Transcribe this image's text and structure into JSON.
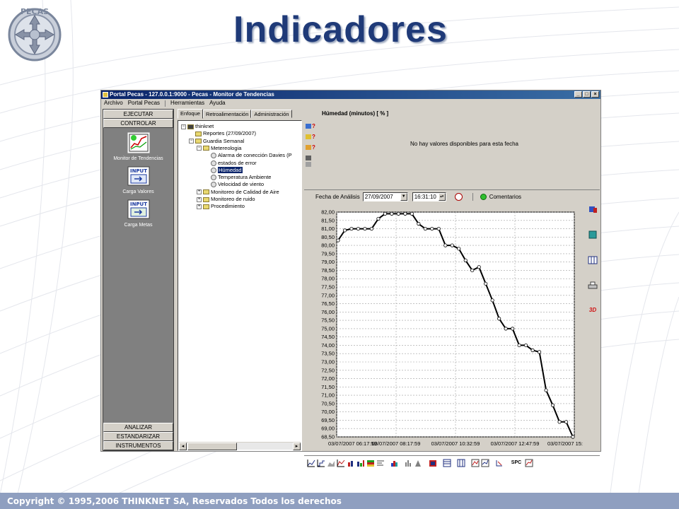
{
  "slide": {
    "title": "Indicadores",
    "logo_text": "PECAS",
    "footer": "Copyright © 1995,2006 THINKNET SA, Reservados Todos los derechos"
  },
  "window": {
    "title": "Portal Pecas - 127.0.0.1:9000 - Pecas - Monitor de Tendencias",
    "buttons": [
      "_",
      "□",
      "×"
    ],
    "menu": [
      "Archivo",
      "Portal Pecas",
      "Herramientas",
      "Ayuda"
    ]
  },
  "left_panel": {
    "sections_top": [
      "EJECUTAR",
      "CONTROLAR"
    ],
    "items": [
      {
        "label": "Monitor de Tendencias",
        "icon": "trend-chart-icon"
      },
      {
        "label": "Carga Valores",
        "icon": "input-values-icon"
      },
      {
        "label": "Carga Metas",
        "icon": "input-goals-icon"
      }
    ],
    "sections_bottom": [
      "ANALIZAR",
      "ESTANDARIZAR",
      "INSTRUMENTOS"
    ]
  },
  "tree_panel": {
    "tabs": [
      "Enfoque",
      "Retroalimentación",
      "Administración"
    ],
    "nodes": [
      {
        "label": "thinknet",
        "level": 0,
        "expander": "−",
        "icon": "root"
      },
      {
        "label": "Reportes (27/09/2007)",
        "level": 1,
        "expander": "",
        "icon": "folder"
      },
      {
        "label": "Guardia Semanal",
        "level": 1,
        "expander": "−",
        "icon": "folder"
      },
      {
        "label": "Metereologia",
        "level": 2,
        "expander": "−",
        "icon": "folder"
      },
      {
        "label": "Alarma de conección Davies (P",
        "level": 3,
        "expander": "",
        "icon": "gauge"
      },
      {
        "label": "estados de error",
        "level": 3,
        "expander": "",
        "icon": "gauge"
      },
      {
        "label": "Húmedad",
        "level": 3,
        "expander": "",
        "icon": "gauge",
        "selected": true
      },
      {
        "label": "Temperatura Ambiente",
        "level": 3,
        "expander": "",
        "icon": "gauge"
      },
      {
        "label": "Velocidad de viento",
        "level": 3,
        "expander": "",
        "icon": "gauge"
      },
      {
        "label": "Monitoreo de Calidad de Aire",
        "level": 2,
        "expander": "+",
        "icon": "folder"
      },
      {
        "label": "Monitoreo de ruido",
        "level": 2,
        "expander": "+",
        "icon": "folder"
      },
      {
        "label": "Procedimiento",
        "level": 2,
        "expander": "+",
        "icon": "folder"
      }
    ]
  },
  "right_panel": {
    "indicator_title": "Húmedad  (minutos) [ % ]",
    "no_data_message": "No hay valores disponibles para esta fecha",
    "date_label": "Fecha de Análisis",
    "date_value": "27/09/2007",
    "time_value": "16:31:10",
    "comments_label": "Comentarios",
    "spc_label": "SPC",
    "side_tool_3d": "3D"
  },
  "chart_data": {
    "type": "line",
    "title": "",
    "xlabel": "",
    "ylabel": "",
    "ylim": [
      68.5,
      82.0
    ],
    "yticks": [
      "82,00",
      "81,50",
      "81,00",
      "80,50",
      "80,00",
      "79,50",
      "79,00",
      "78,50",
      "78,00",
      "77,50",
      "77,00",
      "76,50",
      "76,00",
      "75,50",
      "75,00",
      "74,50",
      "74,00",
      "73,50",
      "73,00",
      "72,50",
      "72,00",
      "71,50",
      "71,00",
      "70,50",
      "70,00",
      "69,50",
      "69,00",
      "68,50"
    ],
    "xticks": [
      "03/07/2007 06:17:59",
      "03/07/2007 08:17:59",
      "03/07/2007 10:32:59",
      "03/07/2007 12:47:59",
      "03/07/2007 15:"
    ],
    "grid": true,
    "series": [
      {
        "color": "#000000",
        "values": [
          80.3,
          80.9,
          81.0,
          81.0,
          81.0,
          81.0,
          81.6,
          81.9,
          81.9,
          81.9,
          81.9,
          81.9,
          81.3,
          81.0,
          81.0,
          81.0,
          80.0,
          80.0,
          79.8,
          79.1,
          78.5,
          78.7,
          77.7,
          76.7,
          75.6,
          75.0,
          75.0,
          74.0,
          74.0,
          73.7,
          73.6,
          71.3,
          70.4,
          69.4,
          69.4,
          68.5
        ]
      }
    ]
  }
}
